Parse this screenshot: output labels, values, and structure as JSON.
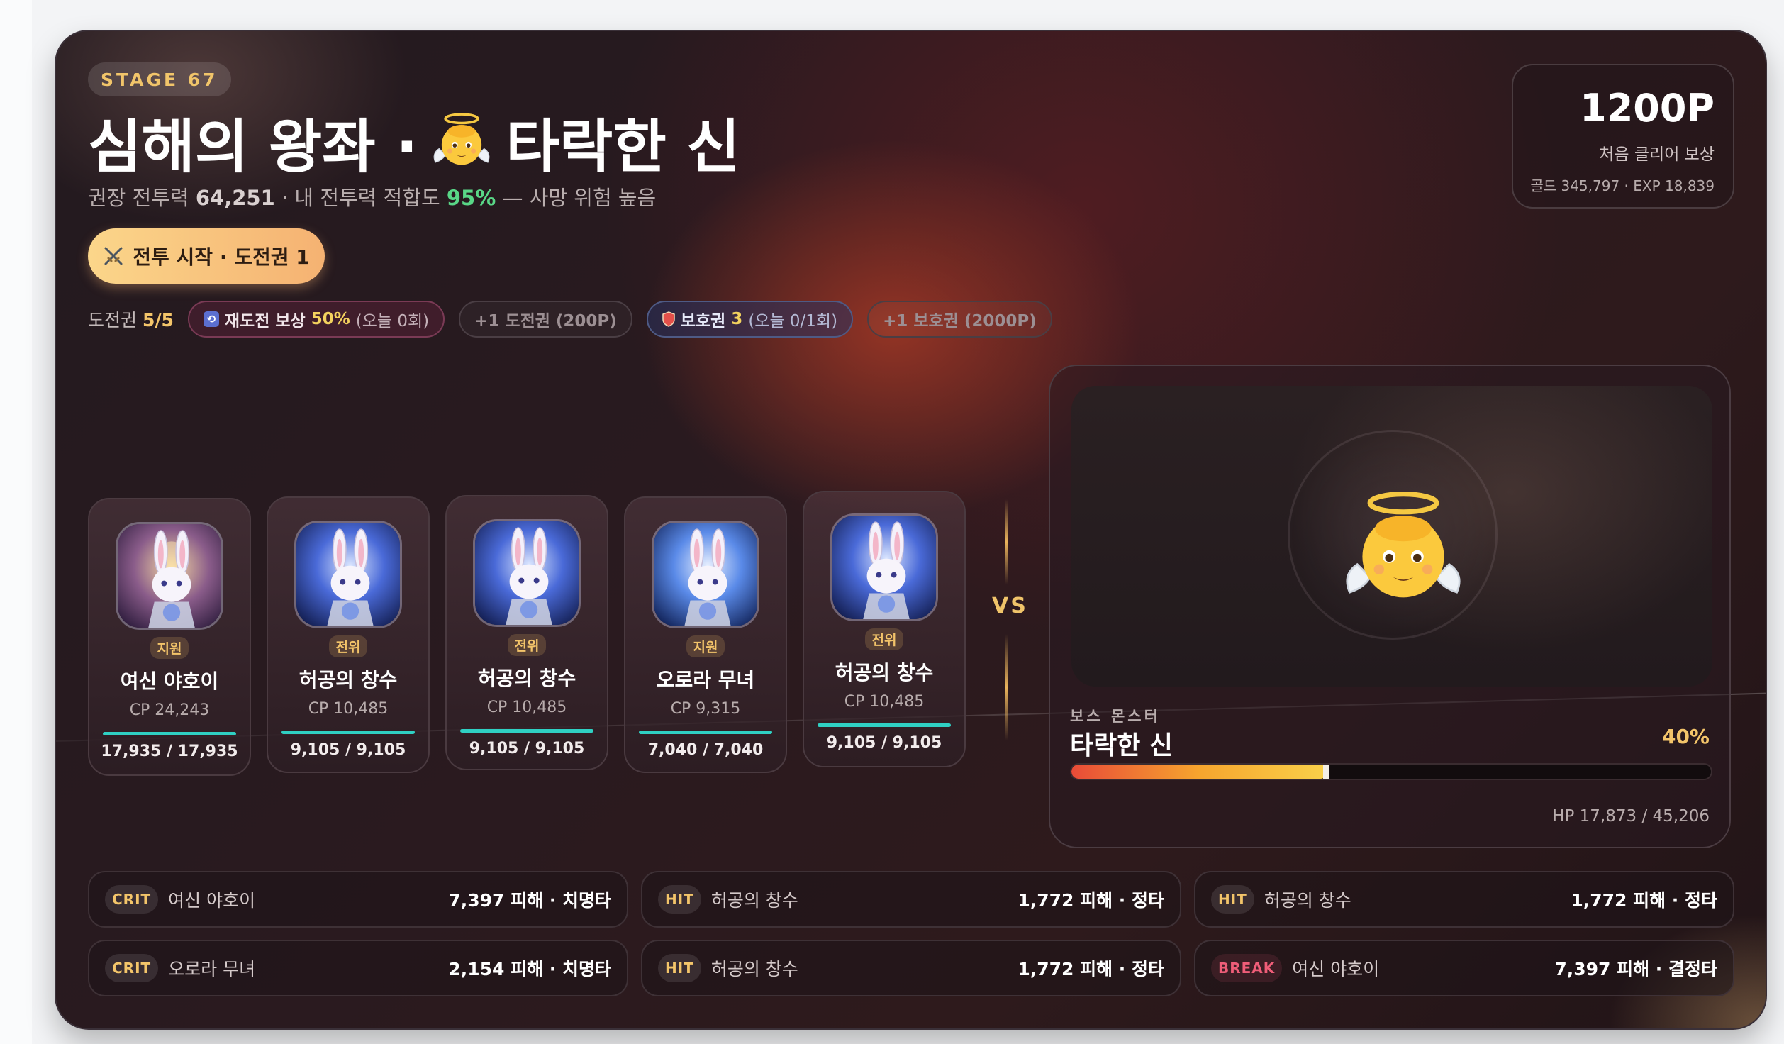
{
  "header": {
    "stage_label": "STAGE 67",
    "title_left": "심해의 왕좌 ·",
    "title_right": "타락한 신",
    "subtitle_prefix": "권장 전투력",
    "recommended_cp": "64,251",
    "subtitle_mid": "· 내 전투력 적합도",
    "fitness": "95%",
    "subtitle_suffix": "— 사망 위험 높음"
  },
  "start_button": {
    "icon": "crossed-swords-icon",
    "label": "전투 시작 · 도전권 1"
  },
  "tickets": {
    "label": "도전권",
    "count": "5/5",
    "retry": {
      "label": "재도전 보상",
      "value": "50%",
      "note": "(오늘 0회)"
    },
    "buy_ticket": "+1 도전권 (200P)",
    "shield": {
      "label": "보호권",
      "value": "3",
      "note": "(오늘 0/1회)"
    },
    "buy_shield": "+1 보호권 (2000P)"
  },
  "reward": {
    "points": "1200P",
    "label": "처음 클리어 보상",
    "detail": "골드 345,797 · EXP 18,839"
  },
  "party": [
    {
      "role": "지원",
      "name": "여신 야호이",
      "cp": "CP 24,243",
      "hp": "17,935 / 17,935",
      "hp_ratio": 1.0,
      "portrait": "goddess-rabbit"
    },
    {
      "role": "전위",
      "name": "허공의 창수",
      "cp": "CP 10,485",
      "hp": "9,105 / 9,105",
      "hp_ratio": 1.0,
      "portrait": "knight-rabbit"
    },
    {
      "role": "전위",
      "name": "허공의 창수",
      "cp": "CP 10,485",
      "hp": "9,105 / 9,105",
      "hp_ratio": 1.0,
      "portrait": "knight-rabbit"
    },
    {
      "role": "지원",
      "name": "오로라 무녀",
      "cp": "CP 9,315",
      "hp": "7,040 / 7,040",
      "hp_ratio": 1.0,
      "portrait": "aurora-rabbit"
    },
    {
      "role": "전위",
      "name": "허공의 창수",
      "cp": "CP 10,485",
      "hp": "9,105 / 9,105",
      "hp_ratio": 1.0,
      "portrait": "knight-rabbit"
    }
  ],
  "vs_label": "VS",
  "boss": {
    "label": "보스 몬스터",
    "name": "타락한 신",
    "hp_percent": "40%",
    "hp_ratio": 0.4,
    "hp_text": "HP 17,873 / 45,206",
    "icon": "angel-baby-icon"
  },
  "combat_log": [
    {
      "tag": "CRIT",
      "actor": "여신 야호이",
      "value": "7,397 피해 · 치명타"
    },
    {
      "tag": "HIT",
      "actor": "허공의 창수",
      "value": "1,772 피해 · 정타"
    },
    {
      "tag": "HIT",
      "actor": "허공의 창수",
      "value": "1,772 피해 · 정타"
    },
    {
      "tag": "CRIT",
      "actor": "오로라 무녀",
      "value": "2,154 피해 · 치명타"
    },
    {
      "tag": "HIT",
      "actor": "허공의 창수",
      "value": "1,772 피해 · 정타"
    },
    {
      "tag": "BREAK",
      "actor": "여신 야호이",
      "value": "7,397 피해 · 결정타"
    }
  ],
  "colors": {
    "accent_gold": "#f3c56a",
    "fitness_green": "#59d787",
    "hp_teal": "#2fd0c3",
    "break_pink": "#ef5d78"
  }
}
